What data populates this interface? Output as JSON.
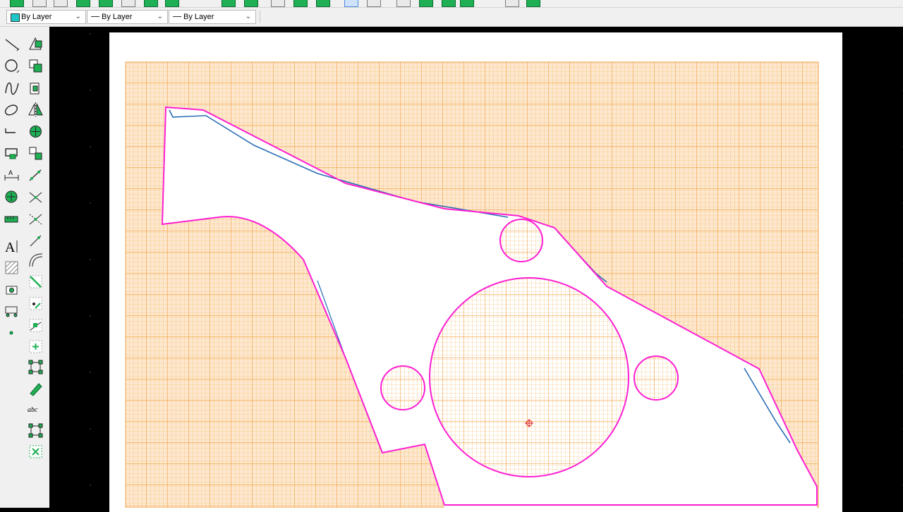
{
  "properties_bar": {
    "layer_combo": {
      "value": "By Layer",
      "color": "#1ec6c6"
    },
    "linetype_combo": {
      "value": "By Layer"
    },
    "lineweight_combo": {
      "value": "By Layer"
    }
  },
  "colors": {
    "accent_tool_green": "#1fb055",
    "shape_outline_magenta": "#ff1fd2",
    "grid_orange": "#f4a23a",
    "ink_blue": "#2a6db5",
    "marker_red": "#e01010"
  },
  "left_toolbar": {
    "column_1": [
      "line-icon",
      "circle-icon",
      "spline-icon",
      "ellipse-icon",
      "polyline-icon",
      "rectangle-icon",
      "dimension-icon",
      "point-icon",
      "measure-icon",
      "text-icon",
      "hatch-icon",
      "camera-icon",
      "block-icon",
      "small-point-icon"
    ],
    "column_2": [
      "select-window-icon",
      "copy-icon",
      "scale-icon",
      "mirror-icon",
      "move-icon",
      "array-icon",
      "stretch-icon",
      "trim-icon",
      "extend-icon",
      "offset-icon",
      "fillet-icon",
      "chamfer-icon",
      "break-icon",
      "join-icon",
      "explode-icon",
      "edit-grips-icon",
      "pencil-icon",
      "spell-check-icon",
      "select-all-icon",
      "delete-selection-icon"
    ],
    "spell_label": "abc"
  }
}
